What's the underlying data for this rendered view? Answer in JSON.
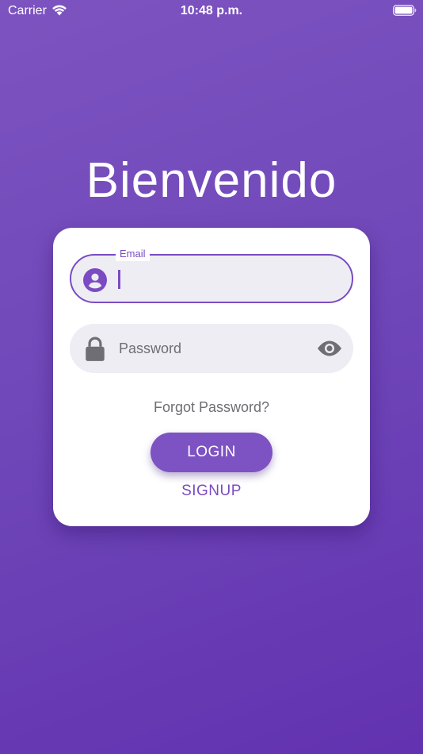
{
  "status_bar": {
    "carrier": "Carrier",
    "time": "10:48 p.m."
  },
  "page": {
    "title": "Bienvenido"
  },
  "login_form": {
    "email": {
      "label": "Email",
      "value": "",
      "icon": "account-circle-icon"
    },
    "password": {
      "placeholder": "Password",
      "value": "",
      "icon": "lock-icon",
      "toggle_icon": "eye-icon"
    },
    "forgot_password": "Forgot Password?",
    "login_label": "LOGIN",
    "signup_label": "SIGNUP"
  },
  "colors": {
    "background_top": "#7d53c0",
    "background_bottom": "#6232b0",
    "accent": "#7a4bc2",
    "button": "#7d52c2",
    "field_background": "#efedf4",
    "muted_text": "#6e6e73"
  }
}
